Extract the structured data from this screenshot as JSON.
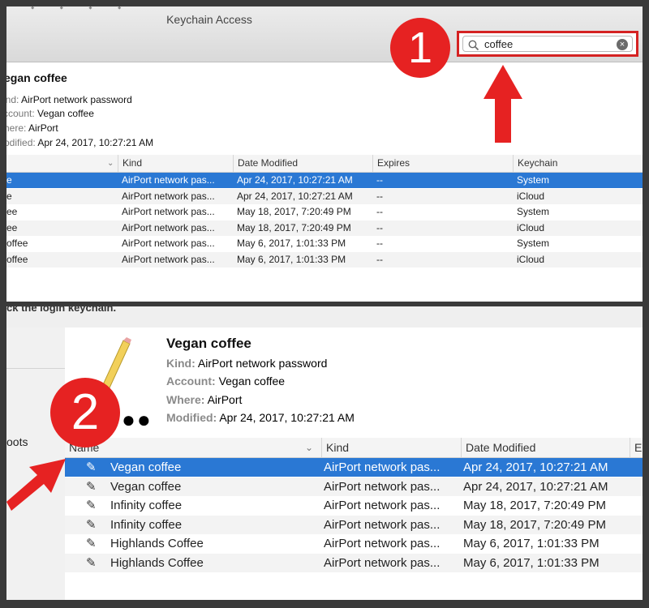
{
  "colors": {
    "accent_selection": "#2a78d4",
    "annotation_red": "#e62222",
    "stripe": "#f3f3f3"
  },
  "top_window": {
    "title": "Keychain Access",
    "search": {
      "value": "coffee",
      "icon": "magnifier-icon",
      "clear_icon": "clear-icon"
    },
    "badge": "1",
    "detail": {
      "name": "egan coffee",
      "kind_label": "ind:",
      "kind_value": "AirPort network password",
      "account_label": "ccount:",
      "account_value": "Vegan coffee",
      "where_label": "here:",
      "where_value": "AirPort",
      "modified_label": "odified:",
      "modified_value": "Apr 24, 2017, 10:27:21 AM"
    },
    "columns": [
      "Kind",
      "Date Modified",
      "Expires",
      "Keychain"
    ],
    "rows": [
      {
        "name": "e",
        "kind": "AirPort network pas...",
        "date": "Apr 24, 2017, 10:27:21 AM",
        "expires": "--",
        "keychain": "System",
        "selected": true
      },
      {
        "name": "e",
        "kind": "AirPort network pas...",
        "date": "Apr 24, 2017, 10:27:21 AM",
        "expires": "--",
        "keychain": "iCloud",
        "selected": false
      },
      {
        "name": "ee",
        "kind": "AirPort network pas...",
        "date": "May 18, 2017, 7:20:49 PM",
        "expires": "--",
        "keychain": "System",
        "selected": false
      },
      {
        "name": "ee",
        "kind": "AirPort network pas...",
        "date": "May 18, 2017, 7:20:49 PM",
        "expires": "--",
        "keychain": "iCloud",
        "selected": false
      },
      {
        "name": "offee",
        "kind": "AirPort network pas...",
        "date": "May 6, 2017, 1:01:33 PM",
        "expires": "--",
        "keychain": "System",
        "selected": false
      },
      {
        "name": "offee",
        "kind": "AirPort network pas...",
        "date": "May 6, 2017, 1:01:33 PM",
        "expires": "--",
        "keychain": "iCloud",
        "selected": false
      }
    ]
  },
  "bottom_window": {
    "strip_text": "ck the login keychain.",
    "sidebar_text": "oots",
    "badge": "2",
    "detail": {
      "name": "Vegan coffee",
      "kind_label": "Kind:",
      "kind_value": "AirPort network password",
      "account_label": "Account:",
      "account_value": "Vegan coffee",
      "where_label": "Where:",
      "where_value": "AirPort",
      "modified_label": "Modified:",
      "modified_value": "Apr 24, 2017, 10:27:21 AM"
    },
    "columns": [
      "Name",
      "Kind",
      "Date Modified",
      "E"
    ],
    "rows": [
      {
        "name": "Vegan coffee",
        "kind": "AirPort network pas...",
        "date": "Apr 24, 2017, 10:27:21 AM",
        "selected": true
      },
      {
        "name": "Vegan coffee",
        "kind": "AirPort network pas...",
        "date": "Apr 24, 2017, 10:27:21 AM",
        "selected": false
      },
      {
        "name": "Infinity coffee",
        "kind": "AirPort network pas...",
        "date": "May 18, 2017, 7:20:49 PM",
        "selected": false
      },
      {
        "name": "Infinity coffee",
        "kind": "AirPort network pas...",
        "date": "May 18, 2017, 7:20:49 PM",
        "selected": false
      },
      {
        "name": "Highlands Coffee",
        "kind": "AirPort network pas...",
        "date": "May 6, 2017, 1:01:33 PM",
        "selected": false
      },
      {
        "name": "Highlands Coffee",
        "kind": "AirPort network pas...",
        "date": "May 6, 2017, 1:01:33 PM",
        "selected": false
      }
    ]
  }
}
